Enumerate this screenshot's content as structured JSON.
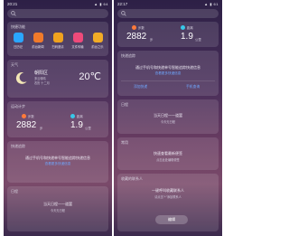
{
  "left": {
    "status_time": "20:21",
    "status_icons": "▲ ▮ 64",
    "shortcut_card": {
      "title": "快捷功能",
      "apps": [
        {
          "label": "日历记",
          "color": "#2aa6ff"
        },
        {
          "label": "前台新闻",
          "color": "#f07a2a"
        },
        {
          "label": "扫码邀请",
          "color": "#f0a21e"
        },
        {
          "label": "文件传输",
          "color": "#ef4a7a"
        },
        {
          "label": "前台之乐",
          "color": "#f2ac26"
        }
      ]
    },
    "weather": {
      "title": "天气",
      "city": "朝阳区",
      "desc": "多云转晴",
      "date": "农历 十二月",
      "temp": "20℃"
    },
    "steps": {
      "title": "运动计步",
      "steps_label": "步数",
      "steps_value": "2882",
      "steps_unit": "步",
      "distance_label": "距离",
      "distance_value": "1.9",
      "distance_unit": "公里"
    },
    "delivery": {
      "title": "快递追踪",
      "message": "通过手机号和快递单号智能追踪快递信息",
      "link": "查看更多快递信息"
    },
    "calendar": {
      "title": "日程",
      "message": "当天日程一一道罢",
      "sub": "今天无日程"
    }
  },
  "right": {
    "status_time": "22:17",
    "status_icons": "▲ ▮ 61",
    "steps": {
      "steps_label": "步数",
      "steps_value": "2882",
      "steps_unit": "步",
      "distance_label": "距离",
      "distance_value": "1.9",
      "distance_unit": "公里"
    },
    "delivery": {
      "title": "快递追踪",
      "message": "通过手机号和快递单号智能追踪快递信息",
      "link": "查看更多快递信息",
      "btn_left": "添加快递",
      "btn_right": "手机查询"
    },
    "calendar": {
      "title": "日程",
      "message": "当天日程一一道罢",
      "sub": "今天无日程"
    },
    "favorite": {
      "title": "常用",
      "message": "快速查看最新便签",
      "sub": "点击此处编辑便签"
    },
    "contacts": {
      "title": "收藏的联系人",
      "message": "一键呼叫收藏联系人",
      "sub": "请点击\"+\"添加联系人",
      "edit": "编辑"
    }
  }
}
